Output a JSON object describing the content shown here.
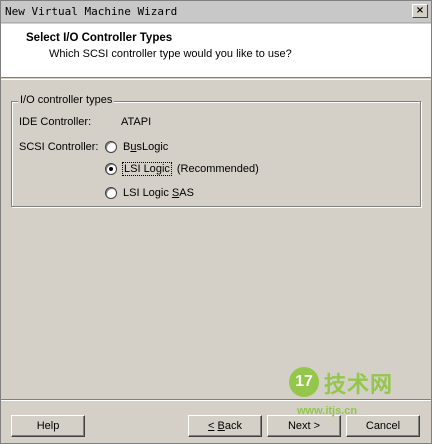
{
  "window": {
    "title": "New Virtual Machine Wizard",
    "close_glyph": "×"
  },
  "header": {
    "title": "Select I/O Controller Types",
    "subtitle": "Which SCSI controller type would you like to use?"
  },
  "group": {
    "legend": "I/O controller types",
    "ide_label": "IDE Controller:",
    "ide_value": "ATAPI",
    "scsi_label": "SCSI Controller:",
    "options": [
      {
        "label": "BusLogic",
        "mnemonic_index": 1,
        "checked": false,
        "note": ""
      },
      {
        "label": "LSI Logic",
        "mnemonic_index": 4,
        "checked": true,
        "note": "(Recommended)"
      },
      {
        "label": "LSI Logic SAS",
        "mnemonic_index": 10,
        "checked": false,
        "note": ""
      }
    ]
  },
  "buttons": {
    "help": "Help",
    "back": "< Back",
    "next": "Next >",
    "cancel": "Cancel"
  },
  "watermark": {
    "badge": "17",
    "text": "技术网",
    "url": "www.itjs.cn"
  }
}
